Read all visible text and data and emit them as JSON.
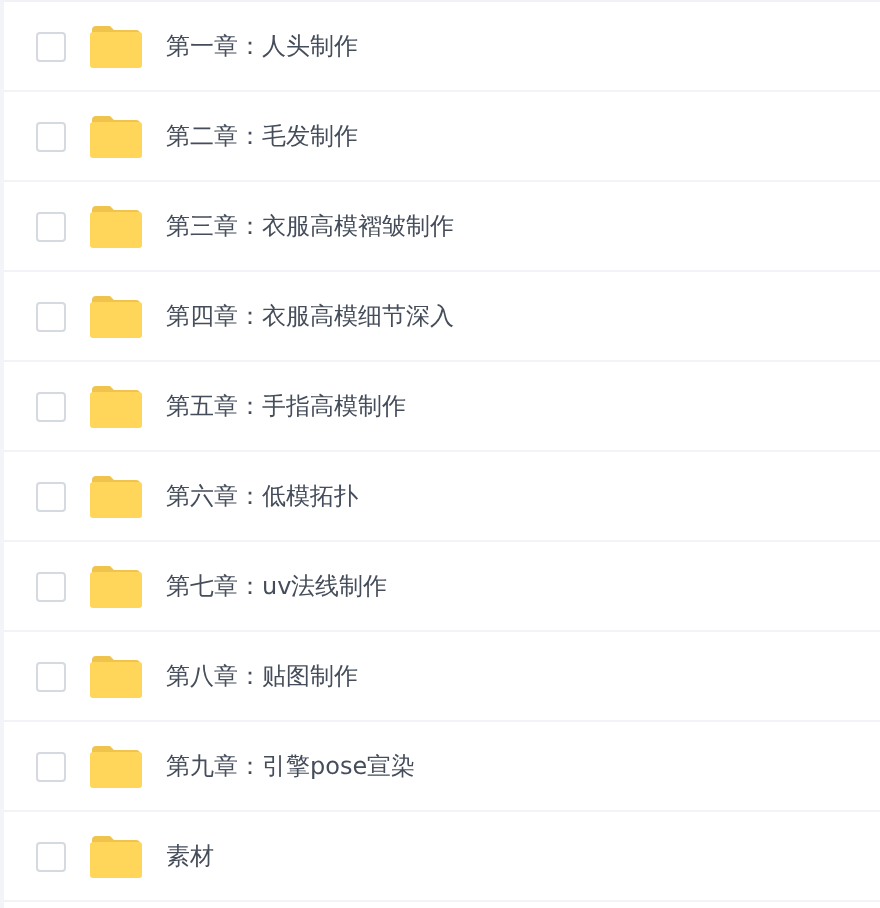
{
  "files": [
    {
      "name": "第一章：人头制作",
      "checked": false
    },
    {
      "name": "第二章：毛发制作",
      "checked": false
    },
    {
      "name": "第三章：衣服高模褶皱制作",
      "checked": false
    },
    {
      "name": "第四章：衣服高模细节深入",
      "checked": false
    },
    {
      "name": "第五章：手指高模制作",
      "checked": false
    },
    {
      "name": "第六章：低模拓扑",
      "checked": false
    },
    {
      "name": "第七章：uv法线制作",
      "checked": false
    },
    {
      "name": "第八章：贴图制作",
      "checked": false
    },
    {
      "name": "第九章：引擎pose宣染",
      "checked": false
    },
    {
      "name": "素材",
      "checked": false
    }
  ]
}
